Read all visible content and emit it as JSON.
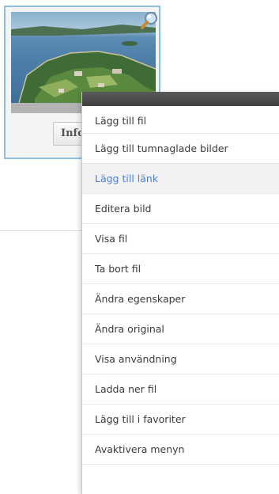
{
  "card": {
    "info_label": "Info"
  },
  "context_menu": {
    "items": [
      {
        "label": "Lägg till fil"
      },
      {
        "label": "Lägg till tumnaglade bilder"
      },
      {
        "label": "Lägg till länk"
      },
      {
        "label": "Editera bild"
      },
      {
        "label": "Visa fil"
      },
      {
        "label": "Ta bort fil"
      },
      {
        "label": "Ändra egenskaper"
      },
      {
        "label": "Ändra original"
      },
      {
        "label": "Visa användning"
      },
      {
        "label": "Ladda ner fil"
      },
      {
        "label": "Lägg till i favoriter"
      },
      {
        "label": "Avaktivera menyn"
      }
    ],
    "highlighted_index": 2
  },
  "colors": {
    "card_border": "#8fbfe0",
    "menu_header": "#4a4a4a",
    "highlight_text": "#4e7fd0"
  }
}
